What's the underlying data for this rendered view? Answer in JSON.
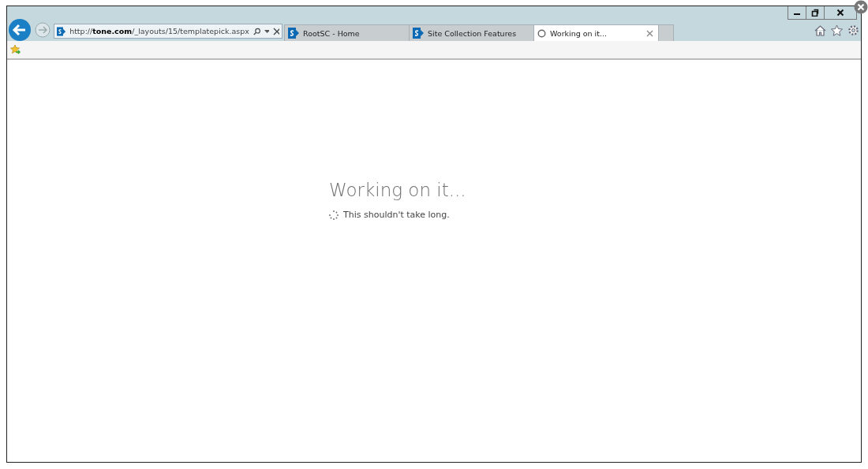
{
  "address_bar": {
    "url": "http://**tone.com**/_layouts/15/templatepick.aspx"
  },
  "tabs": [
    {
      "title": "RootSC - Home",
      "kind": "site",
      "selected": false
    },
    {
      "title": "Site Collection Features",
      "kind": "site",
      "selected": false
    },
    {
      "title": "Working on it...",
      "kind": "loading",
      "selected": true
    }
  ],
  "content": {
    "heading": "Working on it...",
    "message": "This shouldn't take long."
  }
}
